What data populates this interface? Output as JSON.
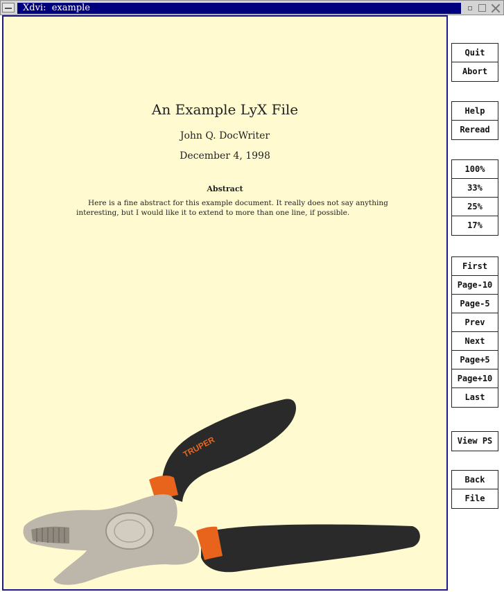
{
  "window": {
    "title": "Xdvi:  example"
  },
  "document": {
    "title": "An Example LyX File",
    "author": "John Q. DocWriter",
    "date": "December 4, 1998",
    "abstract_heading": "Abstract",
    "abstract_line1": "Here is a fine abstract for this example document. It really does not say anything",
    "abstract_line2": "interesting, but I would like it to extend to more than one line, if possible.",
    "image_brand": "TRUPER"
  },
  "panel": {
    "quit": "Quit",
    "abort": "Abort",
    "help": "Help",
    "reread": "Reread",
    "zoom_100": "100%",
    "zoom_33": "33%",
    "zoom_25": "25%",
    "zoom_17": "17%",
    "first": "First",
    "page_minus_10": "Page-10",
    "page_minus_5": "Page-5",
    "prev": "Prev",
    "next": "Next",
    "page_plus_5": "Page+5",
    "page_plus_10": "Page+10",
    "last": "Last",
    "view_ps": "View PS",
    "back": "Back",
    "file": "File"
  },
  "colors": {
    "page_background": "#fffad0",
    "title_bar_active": "#00007e",
    "viewer_border": "#1a1a8c"
  }
}
